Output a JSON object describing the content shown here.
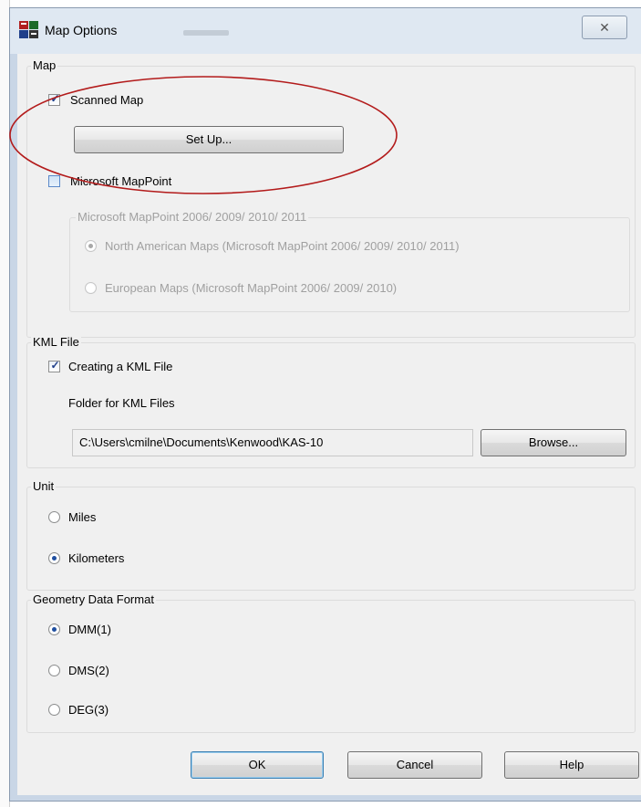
{
  "window": {
    "title": "Map Options",
    "close_glyph": "☒",
    "close_label": "✕"
  },
  "map": {
    "legend": "Map",
    "scanned_map_label": "Scanned Map",
    "scanned_map_checked": true,
    "setup_button": "Set Up...",
    "mappoint_label": "Microsoft MapPoint",
    "mappoint_checked": false,
    "mappoint_group": {
      "legend": "Microsoft MapPoint 2006/ 2009/ 2010/ 2011",
      "options": [
        {
          "label": "North American Maps (Microsoft MapPoint 2006/ 2009/ 2010/ 2011)",
          "selected": true
        },
        {
          "label": "European Maps (Microsoft MapPoint 2006/ 2009/ 2010)",
          "selected": false
        }
      ]
    }
  },
  "kml": {
    "legend": "KML File",
    "create_label": "Creating a KML File",
    "create_checked": true,
    "folder_label": "Folder for KML Files",
    "folder_path": "C:\\Users\\cmilne\\Documents\\Kenwood\\KAS-10",
    "browse_button": "Browse..."
  },
  "unit": {
    "legend": "Unit",
    "options": [
      {
        "label": "Miles",
        "selected": false
      },
      {
        "label": "Kilometers",
        "selected": true
      }
    ]
  },
  "geometry": {
    "legend": "Geometry Data Format",
    "options": [
      {
        "label": "DMM(1)",
        "selected": true
      },
      {
        "label": "DMS(2)",
        "selected": false
      },
      {
        "label": "DEG(3)",
        "selected": false
      }
    ]
  },
  "buttons": {
    "ok": "OK",
    "cancel": "Cancel",
    "help": "Help"
  },
  "colors": {
    "annotation_ellipse": "#b31b1b",
    "window_frame": "#c9d6e6",
    "dialog_bg": "#f0f0f0"
  }
}
